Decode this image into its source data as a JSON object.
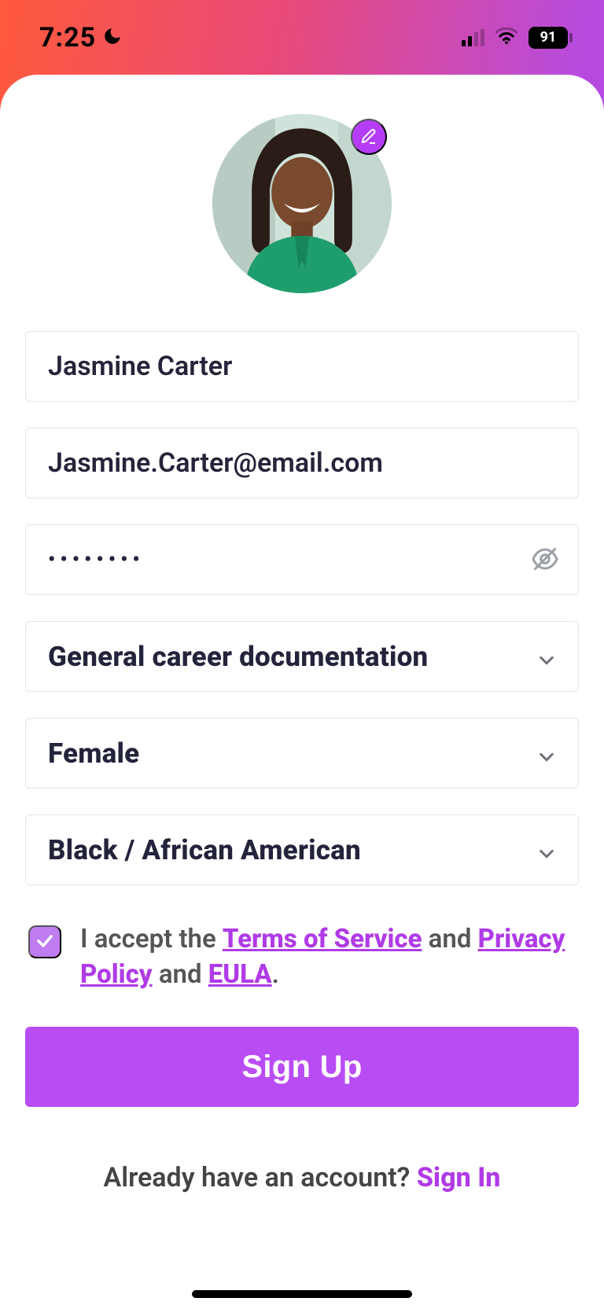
{
  "status": {
    "time": "7:25",
    "battery": "91"
  },
  "form": {
    "name": "Jasmine Carter",
    "email": "Jasmine.Carter@email.com",
    "password_mask": "••••••••",
    "purpose": "General career documentation",
    "gender": "Female",
    "ethnicity": "Black / African American"
  },
  "terms": {
    "prefix": "I accept the ",
    "tos": "Terms of Service",
    "mid1": " and ",
    "privacy": "Privacy Policy",
    "mid2": " and ",
    "eula": "EULA",
    "suffix": "."
  },
  "cta": {
    "signup": "Sign Up"
  },
  "footer": {
    "question": "Already have an account? ",
    "signin": "Sign In"
  }
}
